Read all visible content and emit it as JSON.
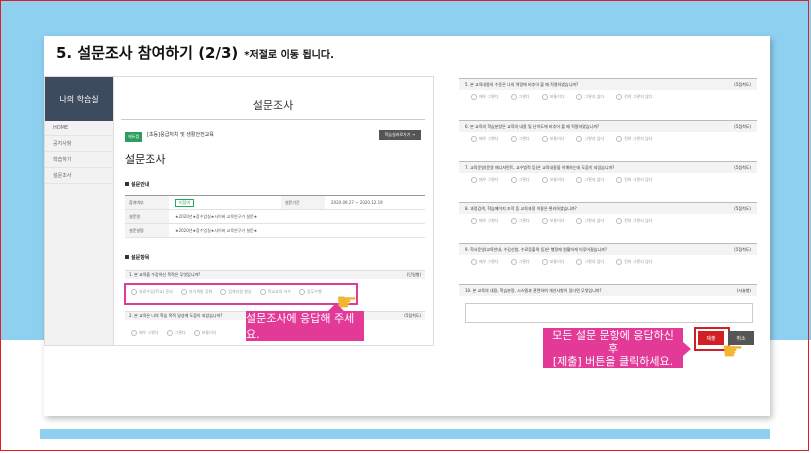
{
  "heading": {
    "title": "5. 설문조사 참여하기 (2/3)",
    "note": "*저절로 이동 됩니다."
  },
  "sidebar": {
    "title": "나의 학습실",
    "items": [
      "HOME",
      "공지사항",
      "학습하기",
      "설문조사"
    ]
  },
  "main": {
    "page_title": "설문조사",
    "category_badge": "에듀캠",
    "course_name": "[초등]응급처치 및 생활안전교육",
    "list_button": "학습실바로가기 →",
    "survey_heading": "설문조사",
    "guide_section": "설문안내",
    "info": [
      {
        "k": "참여여부",
        "v": "미참여",
        "k2": "설문기간",
        "v2": "2020.09.27 ~ 2020.12.19"
      },
      {
        "k": "설문명",
        "v": "★2020년★참수업실★사이버 교육연구기 설문★"
      },
      {
        "k": "설문설명",
        "v": "★2020년★참수업실★사이버 교육연구기 설문★"
      }
    ],
    "items_section": "설문항목",
    "questions": [
      {
        "q": "1. 본 교육을 수강하신 목적은 무엇입니까?",
        "type": "(단일형)",
        "opts": [
          "자료수업(학교) 준비",
          "자기계발 강화",
          "업계지원 향상",
          "학교교육 이수",
          "업무수행"
        ]
      },
      {
        "q": "2. 본 교육은 나의 학습 목적 달성에 도움이 되었습니까?",
        "type": "(5점척도)",
        "opts": [
          "매우 그렇다",
          "그렇다",
          "보통이다",
          "그렇지 않다",
          "전혀 그렇지 않다"
        ]
      }
    ],
    "callout": "설문조사에 응답해 주세요."
  },
  "right": {
    "questions": [
      {
        "q": "5. 본 교육내용의 수준은 나의 역량에 비추어 볼 때 적절하였습니까?",
        "type": "(5점척도)"
      },
      {
        "q": "6. 본 교육의 학습분량은 교육의 내용 및 난이도에 비추어 볼 때 적절하였습니까?",
        "type": "(5점척도)"
      },
      {
        "q": "7. 교육운영(운영 매니저먼트, 교수법적 등)은 교육내용을 이해하는데 도움이 되었습니까?",
        "type": "(5점척도)"
      },
      {
        "q": "8. 과정검색, 학습페이지 조작 등 교육과정 이용은 편리하였습니까?",
        "type": "(5점척도)"
      },
      {
        "q": "9. 학사운영(교육안내, 수강신청, 수료증출력 등)은 행정에 원활하게 이루어졌습니까?",
        "type": "(5점척도)"
      },
      {
        "q": "10. 본 교육의 내용, 학습분량, 시스템과 관련하여 개선사항이 있다면 무엇입니까?",
        "type": "(서술형)"
      }
    ],
    "opts": [
      "매우 그렇다",
      "그렇다",
      "보통이다",
      "그렇지 않다",
      "전혀 그렇지 않다"
    ],
    "submit": "제출",
    "cancel": "취소",
    "callout_line1": "모든 설문 문항에 응답하신",
    "callout_line2": "후",
    "callout_line3": "[제출] 버튼을 클릭하세요."
  },
  "colors": {
    "accent": "#e23a96",
    "submit": "#d21f26",
    "sky": "#8ed0ef"
  },
  "icons": {
    "hand": "pointing-hand-icon"
  }
}
